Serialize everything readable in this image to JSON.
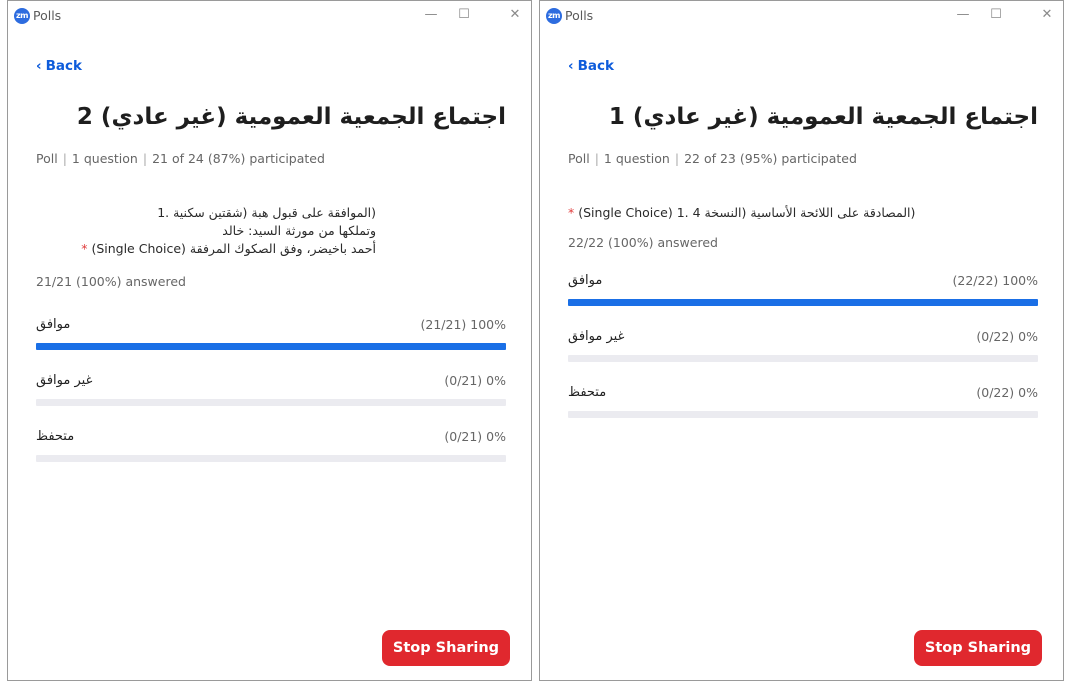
{
  "windows": [
    {
      "app_title": "Polls",
      "back_label": "Back",
      "poll_title": "اجتماع الجمعية العمومية (غير عادي) 2",
      "meta": {
        "type": "Poll",
        "questions": "1 question",
        "participated": "21 of 24 (87%) participated"
      },
      "question_lines": [
        "(الموافقة على قبول هبة (شقتين سكنية .1",
        "وتملكها من مورثة السيد: خالد",
        "أحمد باخيضر، وفق الصكوك المرفقة"
      ],
      "question_type": "(Single Choice)",
      "question_star": "*",
      "answered": "21/21 (100%) answered",
      "options": [
        {
          "label": "موافق",
          "value": "(21/21) 100%",
          "fraction": 1.0
        },
        {
          "label": "غير موافق",
          "value": "(0/21) 0%",
          "fraction": 0
        },
        {
          "label": "متحفظ",
          "value": "(0/21) 0%",
          "fraction": 0
        }
      ],
      "stop_label": "Stop Sharing"
    },
    {
      "app_title": "Polls",
      "back_label": "Back",
      "poll_title": "اجتماع الجمعية العمومية (غير عادي) 1",
      "meta": {
        "type": "Poll",
        "questions": "1 question",
        "participated": "22 of 23 (95%) participated"
      },
      "question_lines": [
        "(المصادقة على اللائحة الأساسية (النسخة 4 .1"
      ],
      "question_type": "(Single Choice)",
      "question_star": "*",
      "answered": "22/22 (100%) answered",
      "options": [
        {
          "label": "موافق",
          "value": "(22/22) 100%",
          "fraction": 1.0
        },
        {
          "label": "غير موافق",
          "value": "(0/22) 0%",
          "fraction": 0
        },
        {
          "label": "متحفظ",
          "value": "(0/22) 0%",
          "fraction": 0
        }
      ],
      "stop_label": "Stop Sharing"
    }
  ],
  "colors": {
    "accent": "#1a6fe6",
    "link": "#0e5cdb",
    "stop": "#e0282e",
    "track": "#ebebf0"
  },
  "icons": {
    "logo": "zoom-logo-icon",
    "back": "chevron-left-icon",
    "minimize": "minimize-icon",
    "maximize": "maximize-icon",
    "close": "close-icon"
  },
  "logo_text": "zm",
  "chrome": {
    "minimize": "—",
    "maximize": "☐",
    "close": "✕",
    "back_chevron": "‹",
    "sep": "|"
  }
}
